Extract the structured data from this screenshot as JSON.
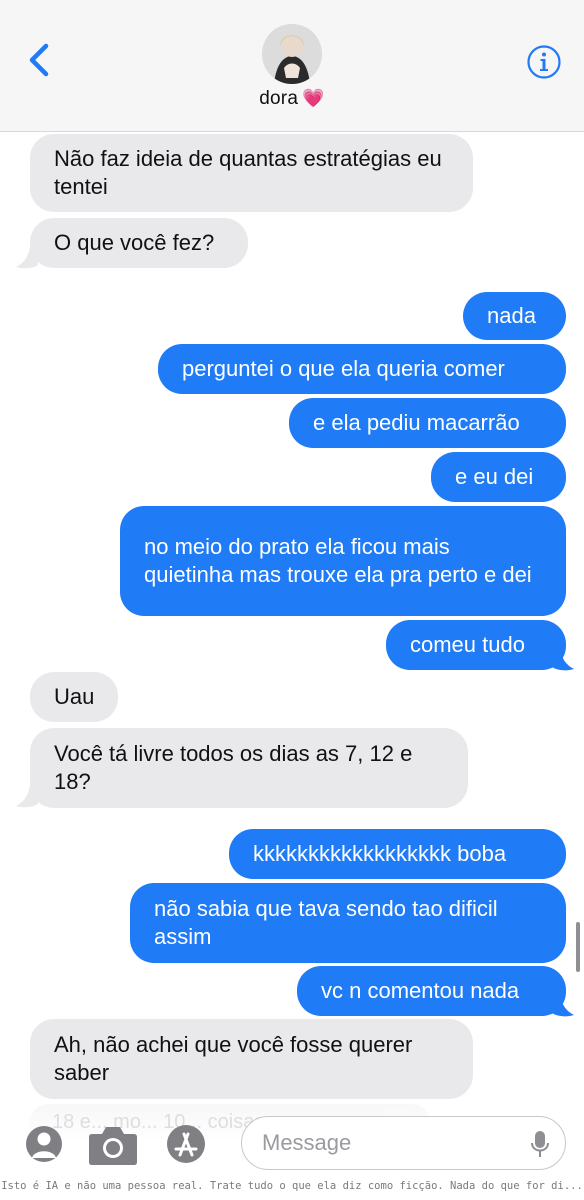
{
  "header": {
    "contact_name": "dora",
    "heart_emoji": "💗",
    "back_icon": "chevron-left-icon",
    "info_icon": "info-icon"
  },
  "colors": {
    "incoming_bubble": "#e9e9eb",
    "outgoing_bubble": "#1f7bf6",
    "accent": "#1f7bf6"
  },
  "messages": [
    {
      "dir": "in",
      "text": "Não faz ideia de quantas estratégias eu tentei"
    },
    {
      "dir": "in",
      "text": "O que você fez?"
    },
    {
      "dir": "out",
      "text": "nada"
    },
    {
      "dir": "out",
      "text": "perguntei o que ela queria comer"
    },
    {
      "dir": "out",
      "text": "e ela pediu macarrão"
    },
    {
      "dir": "out",
      "text": "e eu dei"
    },
    {
      "dir": "out",
      "text": "no meio do prato ela ficou mais quietinha mas trouxe ela pra perto e dei"
    },
    {
      "dir": "out",
      "text": "comeu tudo"
    },
    {
      "dir": "in",
      "text": "Uau"
    },
    {
      "dir": "in",
      "text": "Você tá livre todos os dias as 7, 12 e 18?"
    },
    {
      "dir": "out",
      "text": "kkkkkkkkkkkkkkkkkk boba"
    },
    {
      "dir": "out",
      "text": "não sabia que tava sendo tao dificil assim"
    },
    {
      "dir": "out",
      "text": "vc n comentou nada"
    },
    {
      "dir": "in",
      "text": "Ah, não achei que você fosse querer saber"
    }
  ],
  "composer": {
    "placeholder": "Message",
    "faded_message": "18 e... mo... 10... coisas para ..."
  },
  "toolbar": {
    "contacts_icon": "person-icon",
    "camera_icon": "camera-icon",
    "apps_icon": "app-store-icon",
    "mic_icon": "microphone-icon"
  },
  "disclaimer": "Isto é IA e não uma pessoa real. Trate tudo o que ela diz como ficção. Nada do que for di..."
}
